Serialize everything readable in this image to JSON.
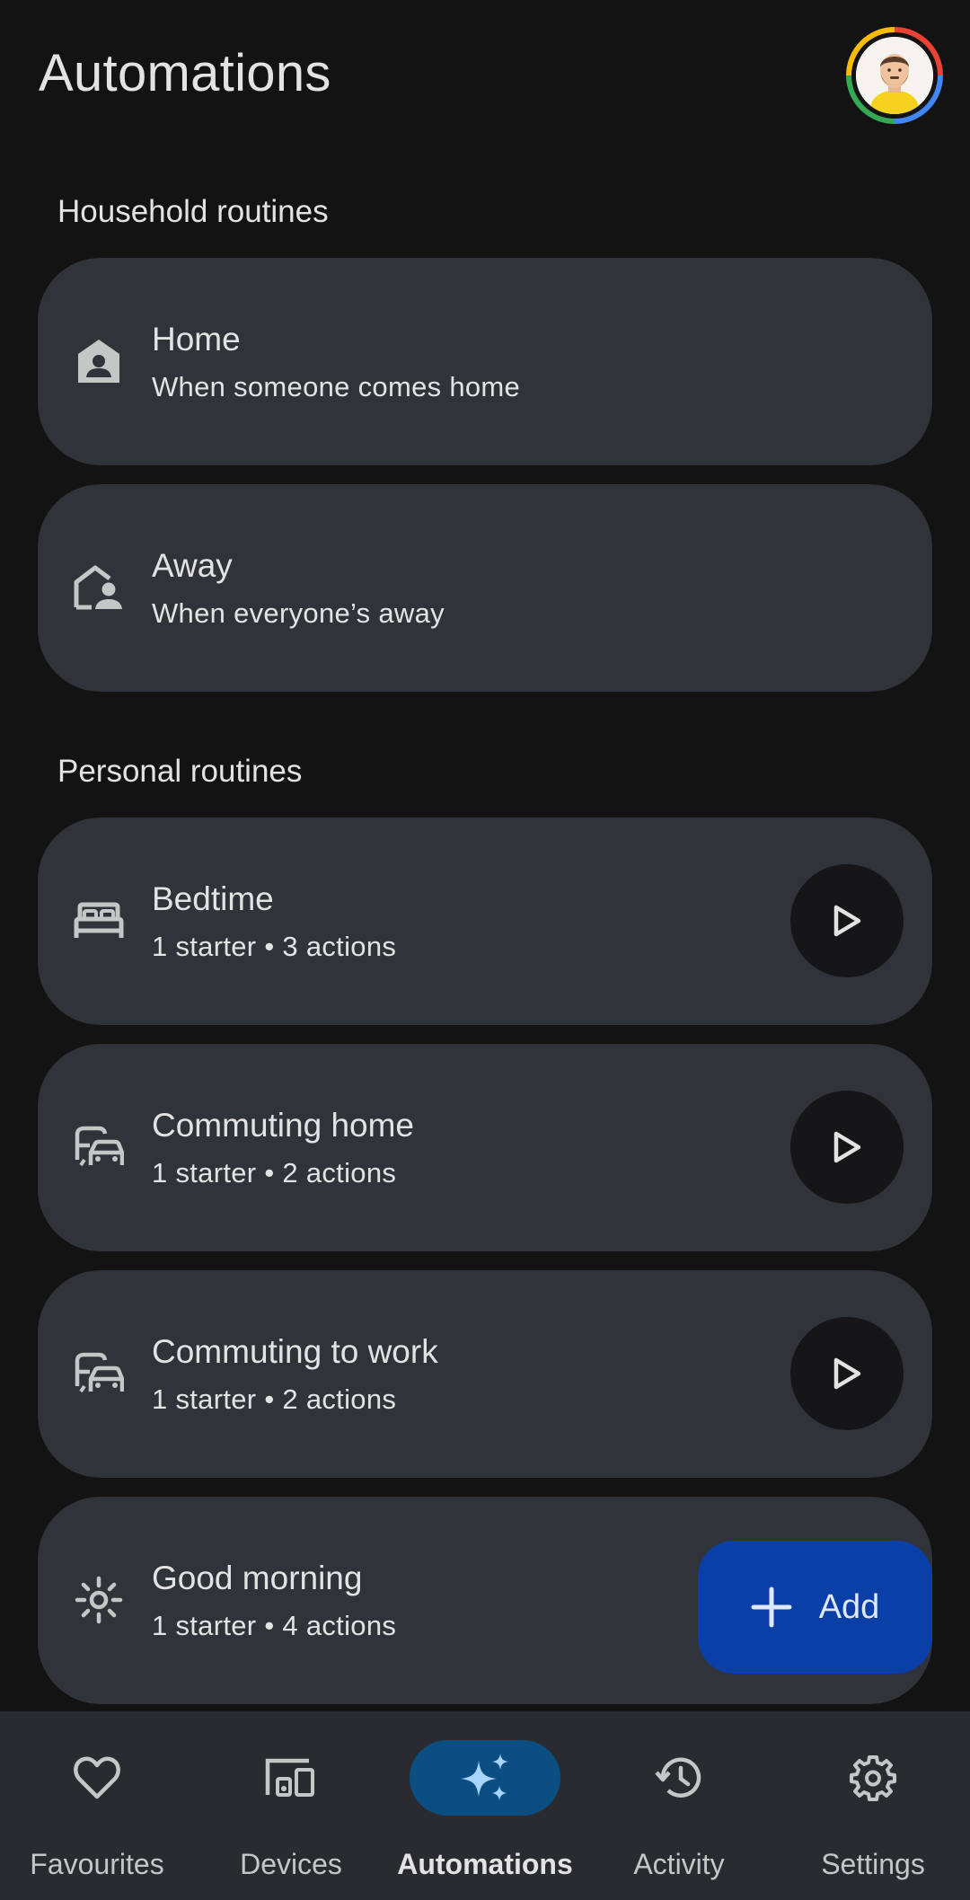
{
  "header": {
    "title": "Automations",
    "avatar_icon": "user-avatar"
  },
  "sections": {
    "household": {
      "heading": "Household routines",
      "items": [
        {
          "title": "Home",
          "subtitle": "When someone comes home",
          "icon": "home-person-icon"
        },
        {
          "title": "Away",
          "subtitle": "When everyone’s away",
          "icon": "away-home-icon"
        }
      ]
    },
    "personal": {
      "heading": "Personal routines",
      "items": [
        {
          "title": "Bedtime",
          "subtitle": "1 starter • 3 actions",
          "icon": "bed-icon"
        },
        {
          "title": "Commuting home",
          "subtitle": "1 starter • 2 actions",
          "icon": "commute-icon"
        },
        {
          "title": "Commuting to work",
          "subtitle": "1 starter • 2 actions",
          "icon": "commute-icon"
        },
        {
          "title": "Good morning",
          "subtitle": "1 starter • 4 actions",
          "icon": "sun-icon"
        }
      ]
    }
  },
  "fab": {
    "label": "Add",
    "icon": "plus-icon"
  },
  "bottom_nav": {
    "items": [
      {
        "label": "Favourites",
        "icon": "heart-icon",
        "active": false
      },
      {
        "label": "Devices",
        "icon": "devices-icon",
        "active": false
      },
      {
        "label": "Automations",
        "icon": "sparkle-icon",
        "active": true
      },
      {
        "label": "Activity",
        "icon": "history-icon",
        "active": false
      },
      {
        "label": "Settings",
        "icon": "gear-icon",
        "active": false
      }
    ]
  },
  "colors": {
    "background": "#131314",
    "card": "#31333a",
    "fab": "#0b3fa8",
    "nav_active_pill": "#0b4f82",
    "nav_bar": "#2a2b30"
  }
}
